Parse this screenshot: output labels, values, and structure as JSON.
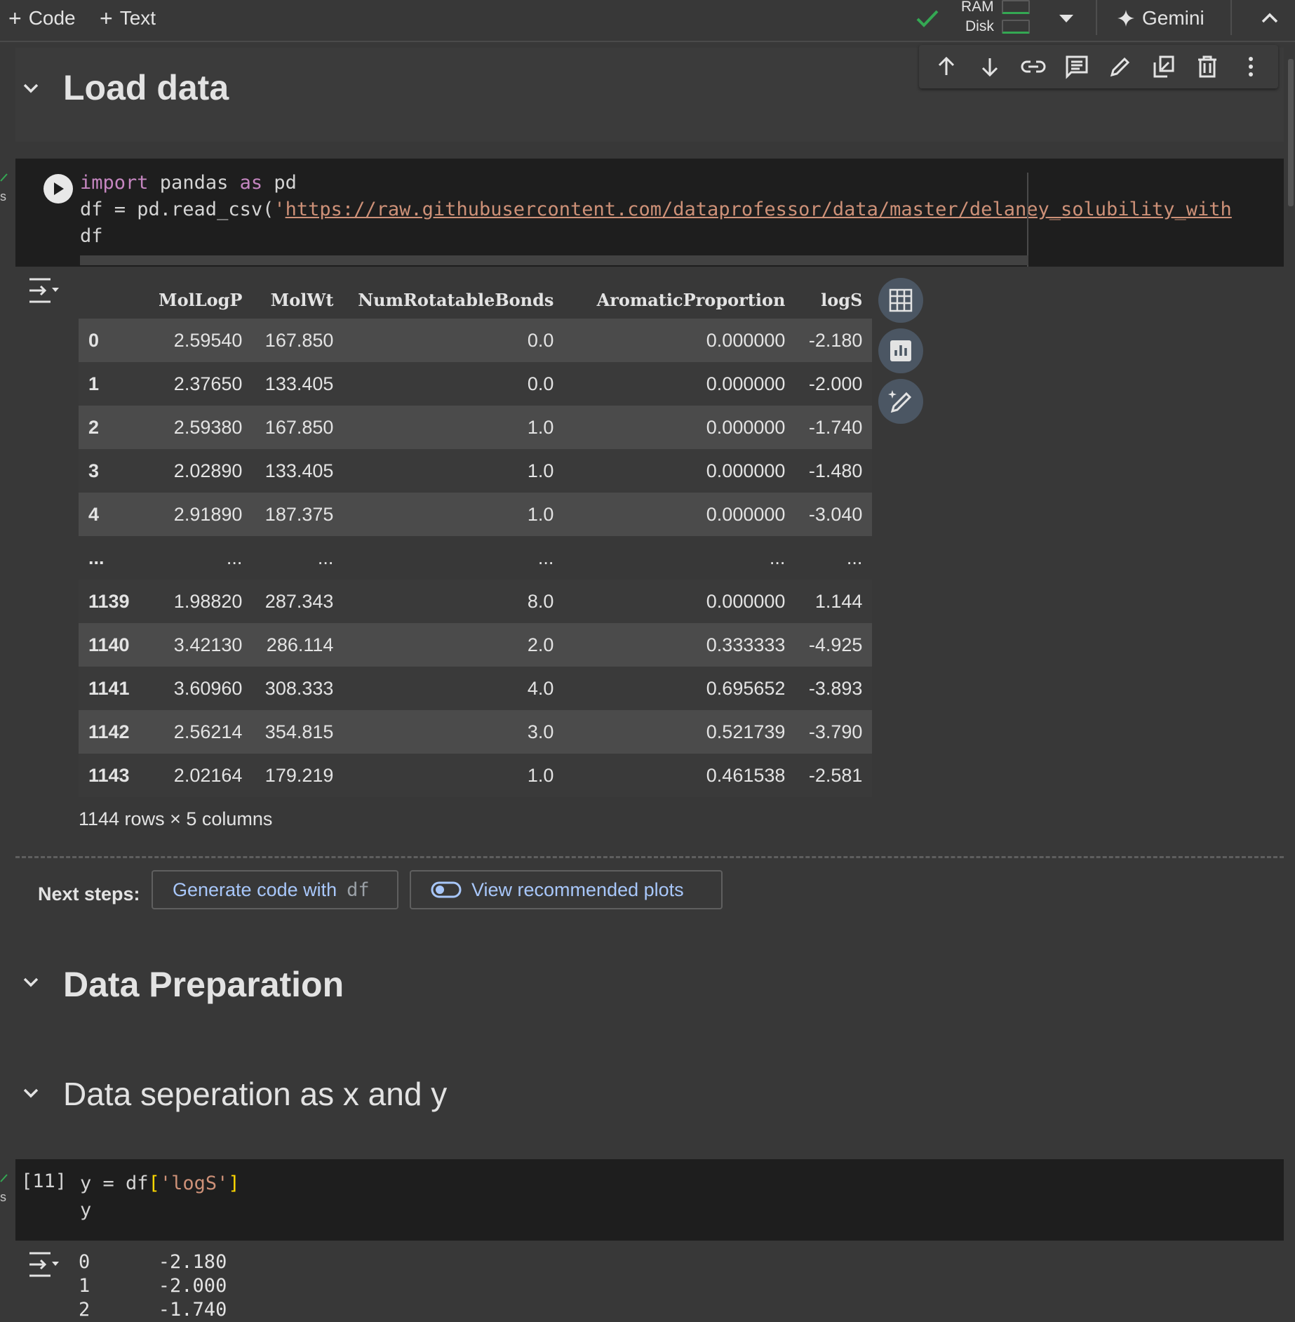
{
  "toolbar": {
    "add_code": "Code",
    "add_text": "Text",
    "ram_label": "RAM",
    "disk_label": "Disk",
    "gemini_label": "Gemini"
  },
  "cell_toolbar": [
    "move-up",
    "move-down",
    "link",
    "comment",
    "edit",
    "mirror",
    "delete",
    "more"
  ],
  "sections": {
    "load_data": "Load data",
    "data_preparation": "Data Preparation",
    "data_separation": "Data seperation as x and y"
  },
  "code_cell_1": {
    "line1_kw1": "import",
    "line1_mid": " pandas ",
    "line1_kw2": "as",
    "line1_end": " pd",
    "line2_pre": "df = pd.read_csv(",
    "line2_quote": "'",
    "line2_url": "https://raw.githubusercontent.com/dataprofessor/data/master/delaney_solubility_with",
    "line3": "df"
  },
  "dataframe": {
    "columns": [
      "MolLogP",
      "MolWt",
      "NumRotatableBonds",
      "AromaticProportion",
      "logS"
    ],
    "rows": [
      [
        "0",
        "2.59540",
        "167.850",
        "0.0",
        "0.000000",
        "-2.180"
      ],
      [
        "1",
        "2.37650",
        "133.405",
        "0.0",
        "0.000000",
        "-2.000"
      ],
      [
        "2",
        "2.59380",
        "167.850",
        "1.0",
        "0.000000",
        "-1.740"
      ],
      [
        "3",
        "2.02890",
        "133.405",
        "1.0",
        "0.000000",
        "-1.480"
      ],
      [
        "4",
        "2.91890",
        "187.375",
        "1.0",
        "0.000000",
        "-3.040"
      ],
      [
        "...",
        "...",
        "...",
        "...",
        "...",
        "..."
      ],
      [
        "1139",
        "1.98820",
        "287.343",
        "8.0",
        "0.000000",
        "1.144"
      ],
      [
        "1140",
        "3.42130",
        "286.114",
        "2.0",
        "0.333333",
        "-4.925"
      ],
      [
        "1141",
        "3.60960",
        "308.333",
        "4.0",
        "0.695652",
        "-3.893"
      ],
      [
        "1142",
        "2.56214",
        "354.815",
        "3.0",
        "0.521739",
        "-3.790"
      ],
      [
        "1143",
        "2.02164",
        "179.219",
        "1.0",
        "0.461538",
        "-2.581"
      ]
    ],
    "shape_note": "1144 rows × 5 columns"
  },
  "next_steps": {
    "label": "Next steps:",
    "generate_prefix": "Generate code with",
    "generate_var": "df",
    "recommended": "View recommended plots"
  },
  "code_cell_2": {
    "exec_count": "[11]",
    "line1_pre": "y = df",
    "line1_open": "[",
    "line1_str": "'logS'",
    "line1_close": "]",
    "line2": "y"
  },
  "series_output": {
    "lines": [
      "0      -2.180",
      "1      -2.000",
      "2      -1.740"
    ]
  }
}
